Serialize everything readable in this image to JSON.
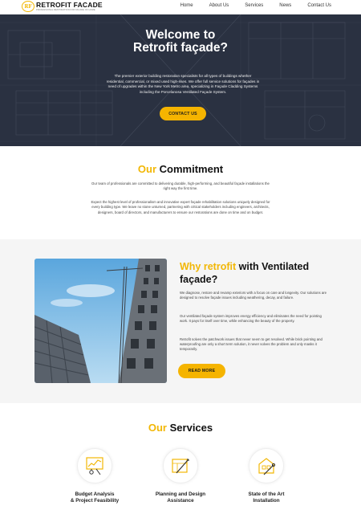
{
  "brand": {
    "logo_mark": "RF",
    "name": "RETROFIT FACADE",
    "tagline": "PROFESSIONAL RESTORATION FOR FACADE OF HOME"
  },
  "nav": {
    "items": [
      "Home",
      "About Us",
      "Services",
      "News",
      "Contact Us"
    ]
  },
  "hero": {
    "title_line1": "Welcome to",
    "title_line2": "Retrofit façade?",
    "text": "The premier exterior building restoration specialists for all types of buildings whether residential, commercial, or mixed used high-rises. We offer full service solutions for façades in need of upgrades within the New York Metro area, specializing in Façade Cladding Systems including the Porcelanosa Ventilated Façade System.",
    "button": "CONTACT US"
  },
  "commitment": {
    "title_highlight": "Our",
    "title_rest": "Commitment",
    "p1": "Our team of professionals are committed to delivering durable, high-performing, and beautiful façade installations the right way the first time.",
    "p2": "Expect the highest level of professionalism and innovative expert façade rehabilitation solutions uniquely designed for every building type. We leave no stone unturned, partnering with critical stakeholders including engineers, architects, designers, board of directors, and manufacturers to ensure our restorations are done on time and on budget."
  },
  "why": {
    "title_highlight": "Why retrofit",
    "title_rest": "with Ventilated façade?",
    "p1": "We diagnose, restore and revamp exteriors with a focus on care and longevity. Our solutions are designed to resolve façade issues including weathering, decay, and failure.",
    "p2": "Our ventilated façade system improves energy efficiency and eliminates the need for pointing work. It pays for itself over time, while enhancing the beauty of the property.",
    "p3": "Retrofit solves the patchwork issues that never seem to get resolved. While brick pointing and waterproofing are only a short term solution, it never solves the problem and only masks it temporarily.",
    "button": "READ MORE"
  },
  "services": {
    "title_highlight": "Our",
    "title_rest": "Services",
    "items": [
      {
        "line1": "Budget Analysis",
        "line2": "& Project Feasibility",
        "icon": "budget-chart-icon"
      },
      {
        "line1": "Planning and Design",
        "line2": "Assistance",
        "icon": "planning-design-icon"
      },
      {
        "line1": "State of the Art",
        "line2": "Installation",
        "icon": "installation-icon"
      }
    ]
  },
  "colors": {
    "accent": "#f2b705",
    "button": "#f5b400",
    "hero_overlay": "#1e2434",
    "section_bg": "#f5f5f5"
  }
}
